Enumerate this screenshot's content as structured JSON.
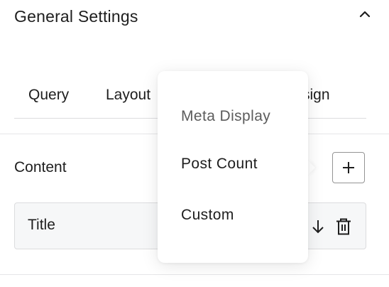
{
  "panel": {
    "title": "General Settings"
  },
  "tabs": [
    {
      "label": "Query"
    },
    {
      "label": "Layout"
    },
    {
      "label": "sign"
    }
  ],
  "content": {
    "label": "Content",
    "items": [
      {
        "label": "Title"
      }
    ]
  },
  "popover": {
    "heading": "Meta Display",
    "items": [
      {
        "label": "Post Count"
      },
      {
        "label": "Custom"
      }
    ]
  },
  "icons": {
    "collapse": "chevron-up-icon",
    "add": "plus-icon",
    "move_down": "arrow-down-icon",
    "delete": "trash-icon"
  },
  "colors": {
    "text": "#1e1e1e",
    "muted": "#5c5c5c",
    "border": "#dcdcde",
    "row_bg": "#f6f7f8"
  }
}
